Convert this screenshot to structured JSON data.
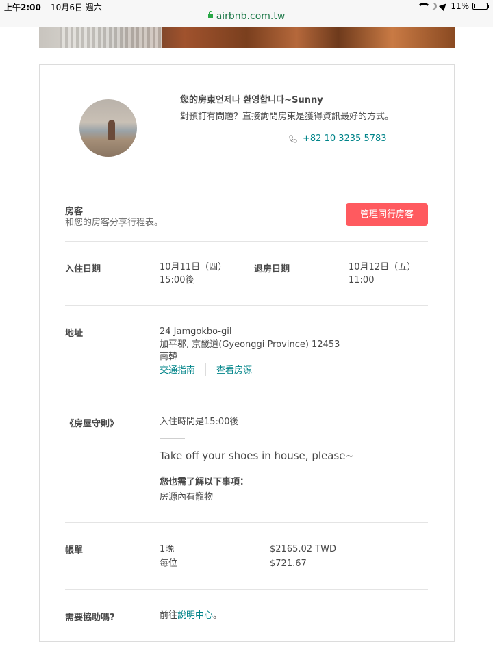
{
  "status_bar": {
    "time": "上午2:00",
    "date": "10月6日 週六",
    "url": "airbnb.com.tw",
    "battery": "11%",
    "battery_level": 0.11
  },
  "host": {
    "greeting": "您的房東언제나 환영합니다~Sunny",
    "subtitle": "對預訂有問題？直接詢問房東是獲得資訊最好的方式。",
    "phone": "+82 10 3235 5783"
  },
  "guests": {
    "label": "房客",
    "description": "和您的房客分享行程表。",
    "button_label": "管理同行房客"
  },
  "dates": {
    "checkin_label": "入住日期",
    "checkin_date": "10月11日（四）",
    "checkin_time": "15:00後",
    "checkout_label": "退房日期",
    "checkout_date": "10月12日（五）",
    "checkout_time": "11:00"
  },
  "address": {
    "label": "地址",
    "line1": "24 Jamgokbo-gil",
    "line2": "加平郡, 京畿道(Gyeonggi Province) 12453",
    "line3": "南韓",
    "directions_link": "交通指南",
    "listing_link": "查看房源"
  },
  "house_rules": {
    "label": "《房屋守則》",
    "checkin_rule": "入住時間是15:00後",
    "custom_rule": "Take off your shoes in house, please~",
    "also_know_heading": "您也需了解以下事項：",
    "also_know_item": "房源內有寵物"
  },
  "bill": {
    "label": "帳單",
    "nights_label": "1晚",
    "nights_amount": "$2165.02 TWD",
    "per_person_label": "每位",
    "per_person_amount": "$721.67"
  },
  "help": {
    "label": "需要協助嗎?",
    "prefix": "前往",
    "link": "說明中心",
    "suffix": "。"
  }
}
